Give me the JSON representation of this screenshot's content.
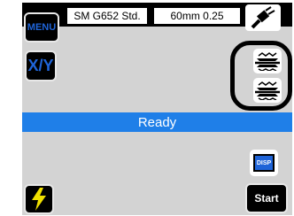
{
  "colors": {
    "background": "#d3d3d3",
    "topbar": "#000000",
    "accent": "#1f64d8",
    "status": "#1f7fe8",
    "lightning": "#f0e000"
  },
  "buttons": {
    "menu_label": "MENU",
    "xy_label": "X/Y",
    "disp_label": "DISP",
    "start_label": "Start"
  },
  "fields": {
    "fiber_type": "SM G652 Std.",
    "cleave_length": "60mm 0.25"
  },
  "status": {
    "text": "Ready"
  },
  "icons": {
    "plug": "plug-icon",
    "clamp": "clamp-icon",
    "lightning": "lightning-icon"
  }
}
